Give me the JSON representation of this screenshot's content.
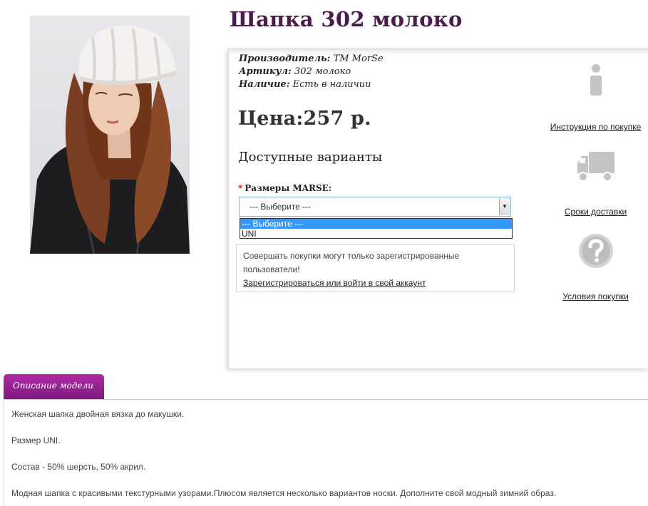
{
  "product": {
    "title": "Шапка 302 молоко",
    "manufacturer_label": "Производитель:",
    "manufacturer_value": "TM MorSe",
    "article_label": "Артикул:",
    "article_value": "302 молоко",
    "availability_label": "Наличие:",
    "availability_value": "Есть в наличии",
    "price": "Цена:257 р."
  },
  "variants": {
    "heading": "Доступные варианты",
    "required_mark": "*",
    "size_label": "Размеры MARSE:",
    "select_value": "--- Выберите ---",
    "options": [
      "--- Выберите ---",
      "UNI"
    ]
  },
  "notice": {
    "text": "Совершать покупки могут только зарегистрированные пользователи!",
    "link": "Зарегистрироваться или войти в свой аккаунт"
  },
  "side_links": {
    "instruction": "Инструкция по покупке",
    "delivery": "Сроки доставки",
    "terms": "Условия покупки"
  },
  "icons": {
    "instruction": "info-icon",
    "delivery": "truck-icon",
    "terms": "question-icon"
  },
  "colors": {
    "title": "#4a1c4c",
    "tab": "#9a2196",
    "dropdown_selected": "#3399ff"
  },
  "description": {
    "tab_label": "Описание модели",
    "lines": [
      "Женская шапка двойная вязка до макушки.",
      "Размер UNI.",
      "Состав - 50% шерсть, 50% акрил.",
      "Модная шапка с красивыми текстурными узорами.Плюсом является несколько вариантов носки. Дополните свой модный зимний образ."
    ]
  }
}
